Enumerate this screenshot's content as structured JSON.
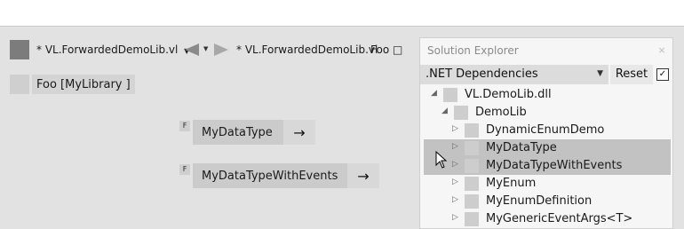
{
  "toolbar": {
    "doc_dropdown": "* VL.ForwardedDemoLib.vl",
    "doc_path": "* VL.ForwardedDemoLib.vl",
    "foo_label": "Foo □"
  },
  "canvas": {
    "foo_node": "Foo   [MyLibrary ]",
    "node1_label": "MyDataType",
    "node2_label": "MyDataTypeWithEvents",
    "badge": "F",
    "arrow": "→"
  },
  "solution_explorer": {
    "title": "Solution Explorer",
    "close": "×",
    "dropdown_value": ".NET Dependencies",
    "reset_label": "Reset",
    "checkbox": "✓",
    "tree": [
      {
        "label": "VL.DemoLib.dll",
        "expanded": true,
        "selected": false
      },
      {
        "label": "DemoLib",
        "expanded": true,
        "selected": false
      },
      {
        "label": "DynamicEnumDemo",
        "expanded": false,
        "selected": false
      },
      {
        "label": "MyDataType",
        "expanded": false,
        "selected": true
      },
      {
        "label": "MyDataTypeWithEvents",
        "expanded": false,
        "selected": true
      },
      {
        "label": "MyEnum",
        "expanded": false,
        "selected": false
      },
      {
        "label": "MyEnumDefinition",
        "expanded": false,
        "selected": false
      },
      {
        "label": "MyGenericEventArgs<T>",
        "expanded": false,
        "selected": false
      }
    ]
  }
}
